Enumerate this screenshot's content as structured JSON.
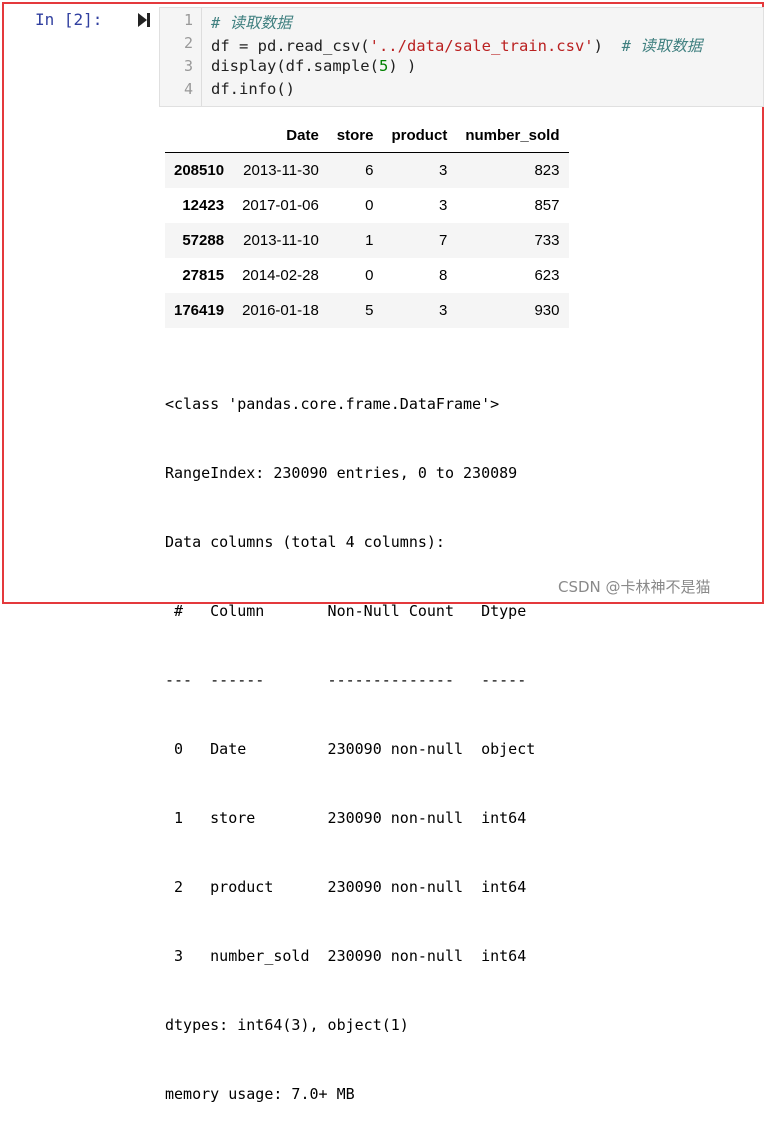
{
  "prompt": "In  [2]:",
  "code_lines": [
    {
      "no": "1",
      "comment": "# 读取数据"
    },
    {
      "no": "2",
      "pre": "df = pd.read_csv(",
      "str": "'../data/sale_train.csv'",
      "post": ")  ",
      "comment": "# 读取数据"
    },
    {
      "no": "3",
      "pre": "display(df.sample(",
      "num": "5",
      "post": ") )"
    },
    {
      "no": "4",
      "pre": "df.info()"
    }
  ],
  "table": {
    "columns": [
      "",
      "Date",
      "store",
      "product",
      "number_sold"
    ],
    "rows": [
      {
        "index": "208510",
        "date": "2013-11-30",
        "store": "6",
        "product": "3",
        "number_sold": "823"
      },
      {
        "index": "12423",
        "date": "2017-01-06",
        "store": "0",
        "product": "3",
        "number_sold": "857"
      },
      {
        "index": "57288",
        "date": "2013-11-10",
        "store": "1",
        "product": "7",
        "number_sold": "733"
      },
      {
        "index": "27815",
        "date": "2014-02-28",
        "store": "0",
        "product": "8",
        "number_sold": "623"
      },
      {
        "index": "176419",
        "date": "2016-01-18",
        "store": "5",
        "product": "3",
        "number_sold": "930"
      }
    ]
  },
  "info_lines": [
    "<class 'pandas.core.frame.DataFrame'>",
    "RangeIndex: 230090 entries, 0 to 230089",
    "Data columns (total 4 columns):",
    " #   Column       Non-Null Count   Dtype ",
    "---  ------       --------------   ----- ",
    " 0   Date         230090 non-null  object",
    " 1   store        230090 non-null  int64 ",
    " 2   product      230090 non-null  int64 ",
    " 3   number_sold  230090 non-null  int64 ",
    "dtypes: int64(3), object(1)",
    "memory usage: 7.0+ MB"
  ],
  "watermark": "CSDN @卡林神不是猫",
  "colors": {
    "frame": "#e4393c",
    "prompt": "#303f9f",
    "comment": "#408080",
    "string": "#ba2121",
    "number": "#008000"
  },
  "icons": {
    "run": "step-forward-icon"
  }
}
